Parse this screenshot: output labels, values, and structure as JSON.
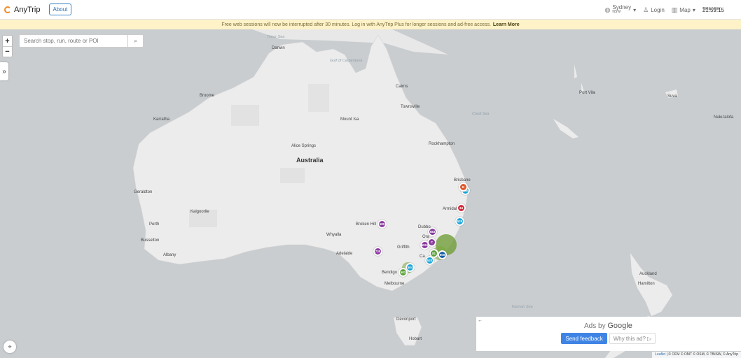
{
  "header": {
    "app_name": "AnyTrip",
    "about_label": "About",
    "region_name": "Sydney",
    "region_sub": "NSW",
    "login_label": "Login",
    "map_label": "Map",
    "time_label": "TIME NOW:",
    "time_value": "21:59:15"
  },
  "banner": {
    "text": "Free web sessions will now be interrupted after 30 minutes. Log in with AnyTrip Plus for longer sessions and ad-free access.",
    "link": "Learn More"
  },
  "search": {
    "placeholder": "Search stop, run, route or POI"
  },
  "zoom": {
    "in": "+",
    "out": "−"
  },
  "map_labels": {
    "country": "Australia",
    "cities": {
      "darwin": "Darwin",
      "broome": "Broome",
      "karratha": "Karratha",
      "mount_isa": "Mount Isa",
      "cairns": "Cairns",
      "townsville": "Townsville",
      "alice_springs": "Alice Springs",
      "rockhampton": "Rockhampton",
      "brisbane": "Brisbane",
      "armidale": "Armidale",
      "geraldton": "Geraldton",
      "kalgoorlie": "Kalgoorlie",
      "perth": "Perth",
      "busselton": "Busselton",
      "albany": "Albany",
      "broken_hill": "Broken Hill",
      "dubbo": "Dubbo",
      "whyalla": "Whyalla",
      "adelaide": "Adelaide",
      "griffith": "Griffith",
      "bendigo": "Bendigo",
      "melbourne": "Melbourne",
      "devonport": "Devonport",
      "hobart": "Hobart",
      "port_vila": "Port Vila",
      "suva": "Suva",
      "nukualofa": "Nuku'alofa",
      "auckland": "Auckland",
      "hamilton": "Hamilton",
      "canberra": "Ca",
      "orange": "Ora"
    },
    "seas": {
      "timor": "Timor Sea",
      "carpentaria": "Gulf of Carpentaria",
      "coral": "Coral Sea",
      "tasman": "Tasman Sea"
    }
  },
  "markers": [
    {
      "label": "6EE",
      "color": "#1aa5d8"
    },
    {
      "label": "E",
      "color": "#e05a2b"
    },
    {
      "label": "34",
      "color": "#d42a3a"
    },
    {
      "label": "525",
      "color": "#1aa5d8"
    },
    {
      "label": "580",
      "color": "#8a3aa0"
    },
    {
      "label": "583",
      "color": "#8a3aa0"
    },
    {
      "label": "5911",
      "color": "#8a3aa0"
    },
    {
      "label": "C",
      "color": "#8a3aa0"
    },
    {
      "label": "81",
      "color": "#5aa03a"
    },
    {
      "label": "600",
      "color": "#1a5fa8"
    },
    {
      "label": "730",
      "color": "#8a3aa0"
    },
    {
      "label": "520",
      "color": "#1aa5d8"
    },
    {
      "label": "504",
      "color": "#1aa5d8"
    },
    {
      "label": "503",
      "color": "#5aa03a"
    }
  ],
  "ads": {
    "back": "←",
    "ads_by": "Ads by",
    "google": "Google",
    "send_feedback": "Send feedback",
    "why_ad": "Why this ad? ▷"
  },
  "attribution": {
    "leaflet": "Leaflet",
    "rest": "| © OFM © OMT © OSM, © TfNSW, © AnyTrip"
  },
  "icons": {
    "globe": "globe-icon",
    "user": "user-icon",
    "map": "map-icon",
    "search": "search-icon",
    "toggle": "chevrons-right-icon",
    "locate": "locate-icon"
  }
}
